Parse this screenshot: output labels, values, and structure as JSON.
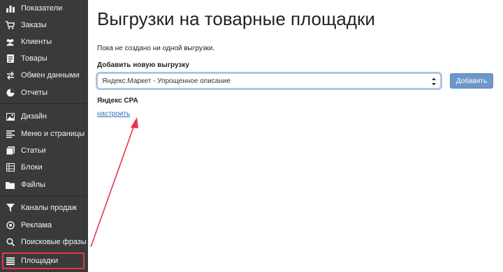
{
  "sidebar": {
    "items": [
      {
        "label": "Показатели",
        "icon": "dashboard-icon"
      },
      {
        "label": "Заказы",
        "icon": "cart-icon"
      },
      {
        "label": "Клиенты",
        "icon": "users-icon"
      },
      {
        "label": "Товары",
        "icon": "products-icon"
      },
      {
        "label": "Обмен данными",
        "icon": "exchange-icon"
      },
      {
        "label": "Отчеты",
        "icon": "pie-chart-icon"
      },
      {
        "label": "Дизайн",
        "icon": "image-icon"
      },
      {
        "label": "Меню и страницы",
        "icon": "menu-lines-icon"
      },
      {
        "label": "Статьи",
        "icon": "articles-icon"
      },
      {
        "label": "Блоки",
        "icon": "blocks-icon"
      },
      {
        "label": "Файлы",
        "icon": "folder-icon"
      },
      {
        "label": "Каналы продаж",
        "icon": "funnel-icon"
      },
      {
        "label": "Реклама",
        "icon": "target-icon"
      },
      {
        "label": "Поисковые фразы",
        "icon": "search-icon"
      },
      {
        "label": "Площадки",
        "icon": "list-icon"
      }
    ],
    "active_item": "Площадки"
  },
  "main": {
    "title": "Выгрузки на товарные площадки",
    "empty_message": "Пока не создано ни одной выгрузки.",
    "add_label": "Добавить новую выгрузку",
    "select_value": "Яндекс.Маркет - Упрощенное описание",
    "add_button": "Добавить",
    "section_title": "Яндекс CPA",
    "configure_link": "настроить"
  },
  "colors": {
    "sidebar_bg": "#3a3a3a",
    "button_bg": "#6d97c9",
    "link": "#2a6fb5",
    "annotation": "#e5344e"
  }
}
